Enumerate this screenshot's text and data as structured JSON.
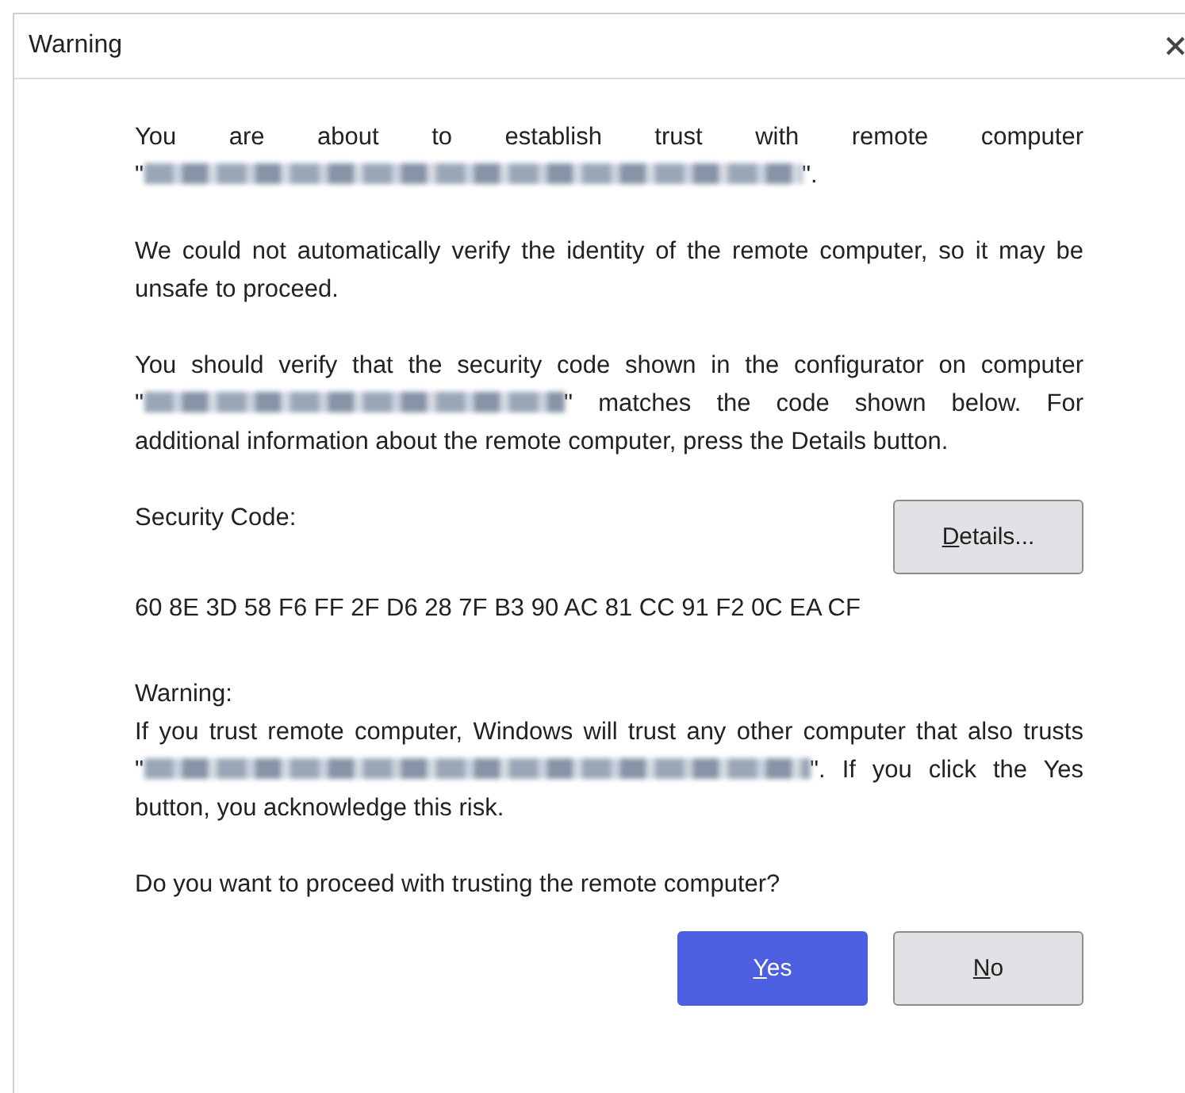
{
  "window": {
    "title": "Warning"
  },
  "paragraphs": [
    {
      "runs": [
        {
          "kind": "text",
          "text": "You are about to establish trust with remote computer"
        },
        {
          "kind": "host",
          "open": "\"",
          "close": "\"."
        }
      ]
    },
    {
      "runs": [
        {
          "kind": "text",
          "text": "We could not automatically verify the identity of the remote computer, so it may be unsafe to proceed."
        }
      ]
    },
    {
      "runs": [
        {
          "kind": "text",
          "text": "You should verify that the security code shown in the configurator on computer"
        },
        {
          "kind": "host",
          "open": "\"",
          "close": "\""
        },
        {
          "kind": "text",
          "text": "matches the code shown below. For additional information about the remote computer, press the Details button."
        }
      ]
    }
  ],
  "security_code": {
    "label": "Security Code:",
    "value": "60 8E 3D 58 F6 FF 2F D6 28 7F B3 90 AC 81 CC 91 F2 0C EA CF"
  },
  "details_button": {
    "label": "Details...",
    "mnemonic": true
  },
  "warning": {
    "heading": "Warning:",
    "runs": [
      {
        "kind": "text",
        "text": "If you trust remote computer, Windows will trust any other computer that also trusts"
      },
      {
        "kind": "host",
        "open": "\"",
        "close": "\"."
      },
      {
        "kind": "text",
        "text": "If you click the Yes button, you acknowledge this risk."
      }
    ]
  },
  "question": "Do you want to proceed with trusting the remote computer?",
  "buttons": [
    {
      "label": "Yes",
      "mnemonic": true,
      "default": true
    },
    {
      "label": "No",
      "mnemonic": true,
      "default": false
    }
  ]
}
